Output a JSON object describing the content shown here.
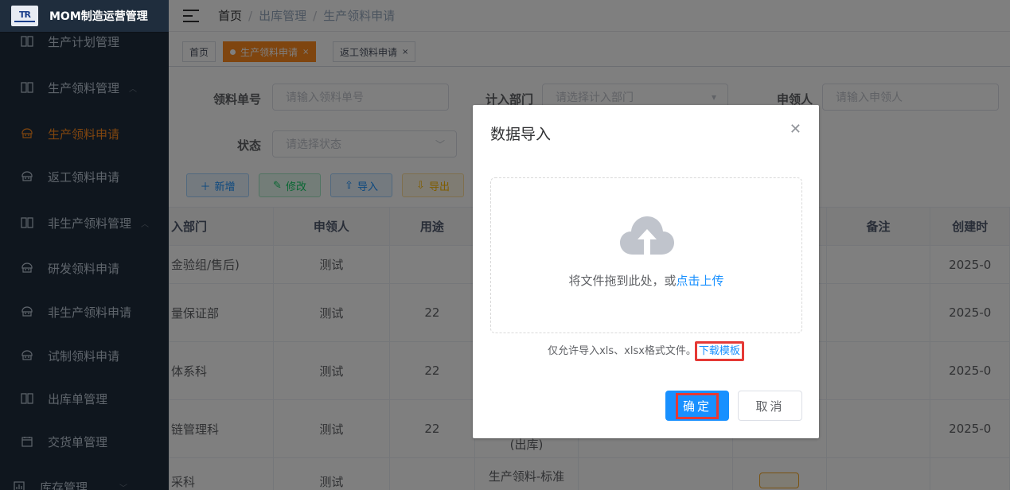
{
  "app": {
    "title": "MOM制造运营管理",
    "logo_text": "TR"
  },
  "sidebar": {
    "items": [
      {
        "label": "生产计划管理",
        "icon": "book-icon",
        "chevron": ""
      },
      {
        "label": "生产领料管理",
        "icon": "book-icon",
        "chevron": "︿"
      },
      {
        "label": "生产领料申请",
        "icon": "robot-icon",
        "active": true
      },
      {
        "label": "返工领料申请",
        "icon": "robot-icon"
      },
      {
        "label": "非生产领料管理",
        "icon": "book-icon",
        "chevron": "︿"
      },
      {
        "label": "研发领料申请",
        "icon": "robot-icon"
      },
      {
        "label": "非生产领料申请",
        "icon": "robot-icon"
      },
      {
        "label": "试制领料申请",
        "icon": "robot-icon"
      },
      {
        "label": "出库单管理",
        "icon": "book-icon"
      },
      {
        "label": "交货单管理",
        "icon": "calendar-icon"
      },
      {
        "label": "库存管理",
        "icon": "chart-icon",
        "chevron": "﹀"
      }
    ]
  },
  "header": {
    "breadcrumb": [
      "首页",
      "出库管理",
      "生产领料申请"
    ]
  },
  "tags": [
    {
      "label": "首页"
    },
    {
      "label": "生产领料申请",
      "active": true
    },
    {
      "label": "返工领料申请"
    }
  ],
  "filters": {
    "order_no": {
      "label": "领料单号",
      "placeholder": "请输入领料单号"
    },
    "department": {
      "label": "计入部门",
      "placeholder": "请选择计入部门"
    },
    "applicant": {
      "label": "申领人",
      "placeholder": "请输入申领人"
    },
    "status": {
      "label": "状态",
      "placeholder": "请选择状态"
    }
  },
  "toolbar": {
    "add": "新增",
    "edit": "修改",
    "import": "导入",
    "export": "导出"
  },
  "table": {
    "headers": [
      "入部门",
      "申领人",
      "用途",
      "",
      "",
      "",
      "备注",
      "创建时"
    ],
    "rows": [
      {
        "dept": "金验组/售后)",
        "applicant": "测试",
        "usage": "",
        "date": "2025-0"
      },
      {
        "dept": "量保证部",
        "applicant": "测试",
        "usage": "22",
        "date": "2025-0"
      },
      {
        "dept": "体系科",
        "applicant": "测试",
        "usage": "22",
        "date": "2025-0"
      },
      {
        "dept": "链管理科",
        "applicant": "测试",
        "usage": "22",
        "type": "(出库)",
        "date": "2025-0"
      },
      {
        "dept": "采科",
        "applicant": "测试",
        "usage": "",
        "type": "生产领料-标准",
        "date": ""
      }
    ]
  },
  "dialog": {
    "title": "数据导入",
    "upload_text": "将文件拖到此处，或",
    "upload_link": "点击上传",
    "tip": "仅允许导入xls、xlsx格式文件。",
    "download_link": "下载模板",
    "ok": "确定",
    "cancel": "取消"
  },
  "colors": {
    "sidebar_bg": "#1f2d3d",
    "accent": "#ff8a1f",
    "primary": "#1890ff",
    "highlight": "#e53935"
  }
}
